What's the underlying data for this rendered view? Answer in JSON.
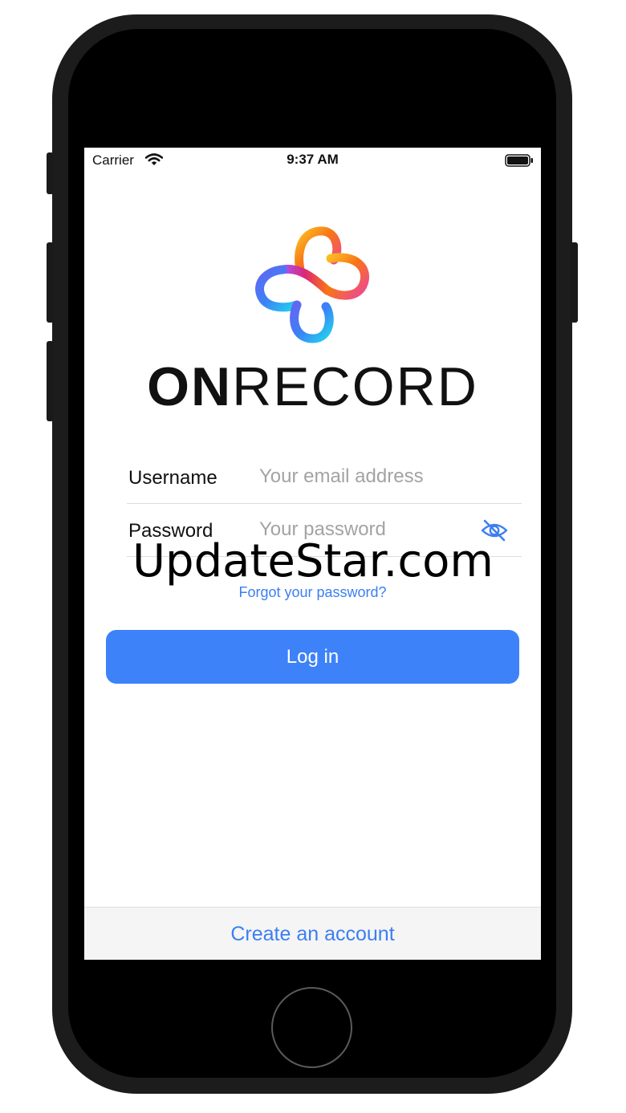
{
  "status_bar": {
    "carrier": "Carrier",
    "time": "9:37 AM",
    "wifi_icon": "wifi-icon",
    "battery_icon": "battery-full-icon"
  },
  "brand": {
    "wordmark_bold": "ON",
    "wordmark_regular": "RECORD",
    "logo_icon": "onrecord-logo-mark",
    "logo_colors": [
      "#fbbf24",
      "#f97316",
      "#ec4899",
      "#a855f7",
      "#3b82f6",
      "#22d3ee"
    ]
  },
  "form": {
    "username_label": "Username",
    "username_placeholder": "Your email address",
    "username_value": "",
    "password_label": "Password",
    "password_placeholder": "Your password",
    "password_value": "",
    "password_toggle_icon": "eye-slash-icon"
  },
  "links": {
    "forgot_password": "Forgot your password?",
    "create_account": "Create an account"
  },
  "actions": {
    "login_label": "Log in"
  },
  "watermark": "UpdateStar.com",
  "colors": {
    "accent": "#3d82f9",
    "link": "#3b7ff2",
    "footer_bg": "#f5f5f5"
  }
}
